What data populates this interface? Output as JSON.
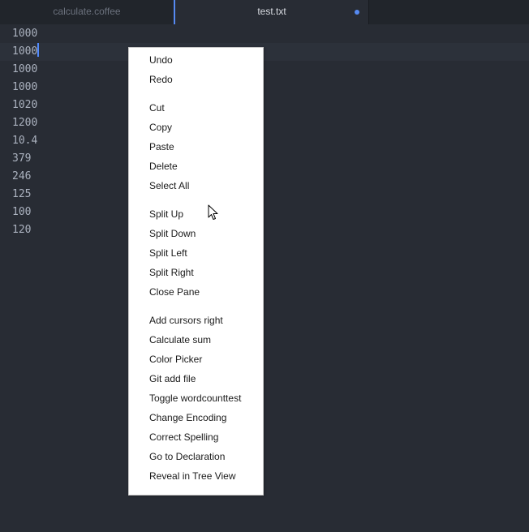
{
  "tabs": [
    {
      "label": "calculate.coffee",
      "active": false
    },
    {
      "label": "test.txt",
      "active": true,
      "modified": true
    }
  ],
  "editor": {
    "lines": [
      "1000",
      "1000",
      "1000",
      "1000",
      "1020",
      "1200",
      "10.4",
      "379",
      "246",
      "125",
      "100",
      "120"
    ],
    "cursor_line": 1
  },
  "context_menu": {
    "groups": [
      [
        "Undo",
        "Redo"
      ],
      [
        "Cut",
        "Copy",
        "Paste",
        "Delete",
        "Select All"
      ],
      [
        "Split Up",
        "Split Down",
        "Split Left",
        "Split Right",
        "Close Pane"
      ],
      [
        "Add cursors right",
        "Calculate sum",
        "Color Picker",
        "Git add file",
        "Toggle wordcounttest",
        "Change Encoding",
        "Correct Spelling",
        "Go to Declaration",
        "Reveal in Tree View"
      ]
    ]
  },
  "colors": {
    "editor_bg": "#282c34",
    "tabbar_bg": "#21252b",
    "accent": "#568af2",
    "text": "#abb2bf",
    "menu_bg": "#ffffff"
  }
}
